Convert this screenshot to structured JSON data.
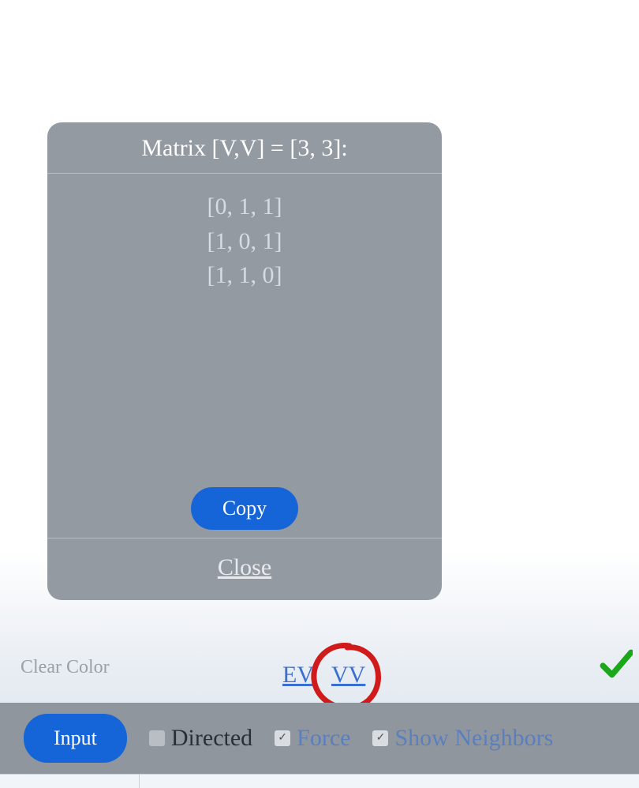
{
  "modal": {
    "title": "Matrix [V,V] = [3, 3]:",
    "rows": [
      "[0, 1, 1]",
      "[1, 0, 1]",
      "[1, 1, 0]"
    ],
    "copy_label": "Copy",
    "close_label": "Close"
  },
  "clear_color_label": "Clear Color",
  "links": {
    "ev": "EV",
    "vv": "VV"
  },
  "toolbar": {
    "input_label": "Input",
    "options": {
      "directed": {
        "label": "Directed",
        "checked": false
      },
      "force": {
        "label": "Force",
        "checked": true
      },
      "show_neighbors": {
        "label": "Show Neighbors",
        "checked": true
      }
    }
  },
  "annotation": {
    "circled": "VV"
  }
}
